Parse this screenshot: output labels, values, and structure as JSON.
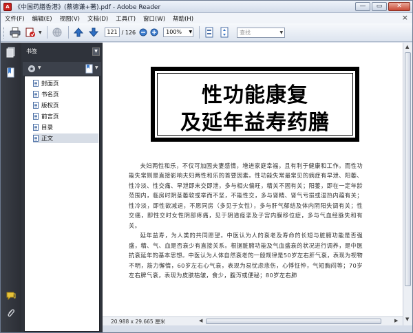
{
  "window": {
    "title": "《中国药膳香港》(蔡德谦+著).pdf - Adobe Reader",
    "controls": [
      "—",
      "▭",
      "✕"
    ]
  },
  "menu": [
    "文件(F)",
    "编辑(E)",
    "视图(V)",
    "文档(D)",
    "工具(T)",
    "窗口(W)",
    "帮助(H)"
  ],
  "menu_close": "×",
  "toolbar": {
    "current_page": "121",
    "page_total": "/ 126",
    "zoom": "100%",
    "search_placeholder": "查找"
  },
  "bookmarks": {
    "panel_title": "书签",
    "items": [
      {
        "label": "封面页",
        "selected": false
      },
      {
        "label": "书名页",
        "selected": false
      },
      {
        "label": "版权页",
        "selected": false
      },
      {
        "label": "前言页",
        "selected": false
      },
      {
        "label": "目录",
        "selected": false
      },
      {
        "label": "正文",
        "selected": true
      }
    ]
  },
  "status": {
    "page_size": "20.988 x 29.665 厘米"
  },
  "page": {
    "heading_line1": "性功能康复",
    "heading_line2": "及延年益寿药膳",
    "paragraph1": "夫妇两性和乐，不仅可加固夫妻感情，增进家庭幸福，且有利于健康和工作。而性功能失常则是直接影响夫妇两性和乐的首要因素。性功能失常最常见的病症有早泄、阳萎、性冷淡、性交痛、早泄即末交即泄，多与相火偏旺，精关不固有关；阳萎，即在一定年龄范围内，临房时阴茎萎软或举而不坚，不能性交，多与肾精、肾气亏损或湿热内蕴有关；性冷淡，即性欲减退，不愿同房（多见于女性），多与肝气郁结及体内阴阳失调有关；性交痛，即性交时女性阴部疼痛，见于阴道痉挛及子宫内膜移位症，多与气血经脉失和有关。",
    "paragraph2": "延年益寿，为人类的共同愿望。中医认为人的衰老及寿命的长短与脏腑功能是否强盛，精、气、血是否衰少有直接关系。根据脏腑功能及气血盛衰的状况进行调养，是中医抗衰延年的基本思想。中医认为人体自然衰老的一般规律是50岁左右肝气衰，表现为视物不明，筋力懈惰，60岁左右心气衰，表现为易忧虑悲伤，心悸怔忡，气短胸闷等；70岁左右脾气衰，表现为皮肤枯皱，食少，腹泻或便秘；80岁左右肺"
  }
}
